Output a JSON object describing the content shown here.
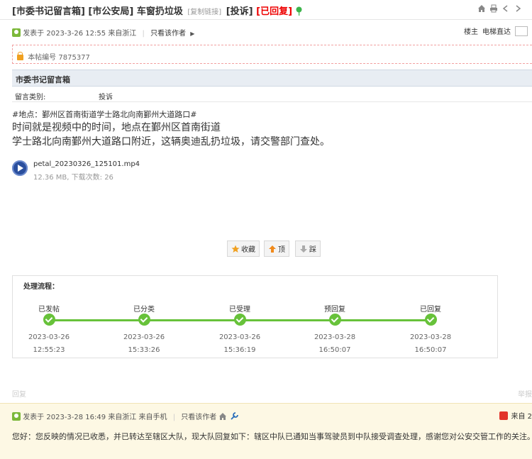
{
  "header": {
    "tag1": "[市委书记留言箱]",
    "tag2": "[市公安局]",
    "subject": "车窗扔垃圾",
    "copy_link": "[复制链接]",
    "complaint_tag": "[投诉]",
    "status_tag": "[已回复]"
  },
  "post": {
    "posted_label": "发表于",
    "datetime": "2023-3-26 12:55",
    "from": "来自浙江",
    "only_author": "只看该作者",
    "floor_label": "楼主",
    "jump_label": "电梯直达",
    "post_number": "本帖编号 7875377"
  },
  "box": {
    "title": "市委书记留言箱",
    "category_label": "留言类别:",
    "category_value": "投诉"
  },
  "content": {
    "hashtag": "#地点：鄞州区首南街道学士路北向南鄞州大道路口#",
    "line1": "时间就是视频中的时间，地点在鄞州区首南街道",
    "line2": "学士路北向南鄞州大道路口附近，这辆奥迪乱扔垃圾，请交警部门查处。"
  },
  "attachment": {
    "filename": "petal_20230326_125101.mp4",
    "info": "12.36 MB, 下载次数: 26"
  },
  "actions": {
    "favorite": "收藏",
    "up": "顶",
    "down": "踩"
  },
  "process": {
    "title": "处理流程：",
    "steps": [
      {
        "label": "已发帖",
        "date": "2023-03-26",
        "time": "12:55:23"
      },
      {
        "label": "已分类",
        "date": "2023-03-26",
        "time": "15:33:26"
      },
      {
        "label": "已受理",
        "date": "2023-03-26",
        "time": "15:36:19"
      },
      {
        "label": "预回复",
        "date": "2023-03-28",
        "time": "16:50:07"
      },
      {
        "label": "已回复",
        "date": "2023-03-28",
        "time": "16:50:07"
      }
    ]
  },
  "faded": {
    "reply": "回复",
    "right": "举报"
  },
  "reply": {
    "posted_label": "发表于",
    "datetime": "2023-3-28 16:49",
    "from": "来自浙江 来自手机",
    "only_author": "只看该作者",
    "right_text": "来自 2",
    "body": "您好：您反映的情况已收悉，并已转达至辖区大队，现大队回复如下：辖区中队已通知当事驾驶员到中队接受调查处理，感谢您对公安交管工作的关注。"
  },
  "colors": {
    "accent_green": "#67c23a",
    "status_red": "#e00000",
    "header_bg": "#e8edf3",
    "reply_bg": "#fdf8e4"
  },
  "icons": [
    "pin-icon",
    "home-icon",
    "print-icon",
    "prev-icon",
    "next-icon",
    "user-icon",
    "lock-icon",
    "play-icon",
    "star-icon",
    "up-arrow-icon",
    "down-arrow-icon",
    "check-icon",
    "wrench-icon"
  ]
}
